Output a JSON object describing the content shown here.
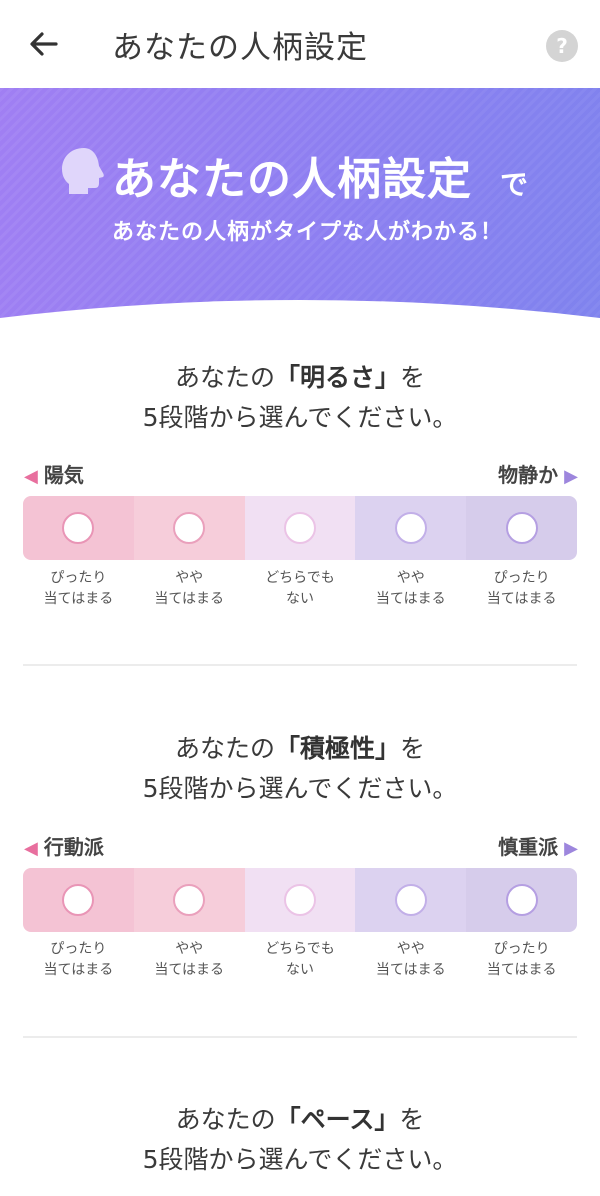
{
  "header": {
    "title": "あなたの人柄設定",
    "help_label": "?"
  },
  "banner": {
    "title": "あなたの人柄設定",
    "title_suffix": "で",
    "subtitle": "あなたの人柄がタイプな人がわかる！"
  },
  "choice_labels": [
    {
      "line1": "ぴったり",
      "line2": "当てはまる"
    },
    {
      "line1": "やや",
      "line2": "当てはまる"
    },
    {
      "line1": "どちらでも",
      "line2": "ない"
    },
    {
      "line1": "やや",
      "line2": "当てはまる"
    },
    {
      "line1": "ぴったり",
      "line2": "当てはまる"
    }
  ],
  "questions": [
    {
      "prefix": "あなたの",
      "trait": "「明るさ」",
      "suffix": "を",
      "line2": "5段階から選んでください。",
      "left_label": "陽気",
      "right_label": "物静か"
    },
    {
      "prefix": "あなたの",
      "trait": "「積極性」",
      "suffix": "を",
      "line2": "5段階から選んでください。",
      "left_label": "行動派",
      "right_label": "慎重派"
    },
    {
      "prefix": "あなたの",
      "trait": "「ペース」",
      "suffix": "を",
      "line2": "5段階から選んでください。"
    }
  ],
  "colors": {
    "banner_start": "#a07ff3",
    "banner_end": "#7f83ee",
    "left_accent": "#e86f9e",
    "right_accent": "#9d86dd"
  }
}
